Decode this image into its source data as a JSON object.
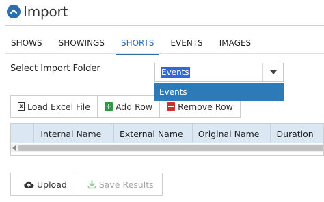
{
  "page": {
    "title": "Import"
  },
  "tabs": [
    {
      "label": "SHOWS",
      "active": false
    },
    {
      "label": "SHOWINGS",
      "active": false
    },
    {
      "label": "SHORTS",
      "active": true
    },
    {
      "label": "EVENTS",
      "active": false
    },
    {
      "label": "IMAGES",
      "active": false
    }
  ],
  "folder": {
    "label": "Select Import Folder",
    "selected": "Events",
    "options": [
      "Events"
    ]
  },
  "toolbar": {
    "load_excel_label": "Load Excel File",
    "add_row_label": "Add Row",
    "remove_row_label": "Remove Row"
  },
  "grid": {
    "columns": [
      "Internal Name",
      "External Name",
      "Original Name",
      "Duration"
    ]
  },
  "actions": {
    "upload_label": "Upload",
    "save_results_label": "Save Results"
  },
  "colors": {
    "accent": "#2d6fad",
    "dropdown_highlight": "#2d7ab8",
    "grid_header": "#dbe7f3",
    "add_green": "#2e9a3e",
    "remove_red": "#c8352c"
  }
}
